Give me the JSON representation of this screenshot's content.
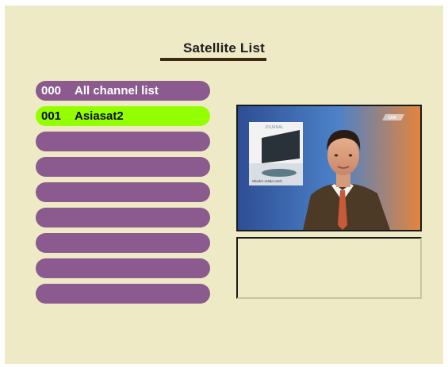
{
  "screen": {
    "title": "Satellite List",
    "colors": {
      "background": "#eeeac5",
      "item": "#8b5a8e",
      "item_selected": "#94ff00",
      "underline": "#3d2a10"
    }
  },
  "satellite_list": [
    {
      "number": "000",
      "name": "All channel list",
      "selected": false
    },
    {
      "number": "001",
      "name": "Asiasat2",
      "selected": true
    },
    {
      "number": "",
      "name": "",
      "selected": false
    },
    {
      "number": "",
      "name": "",
      "selected": false
    },
    {
      "number": "",
      "name": "",
      "selected": false
    },
    {
      "number": "",
      "name": "",
      "selected": false
    },
    {
      "number": "",
      "name": "",
      "selected": false
    },
    {
      "number": "",
      "name": "",
      "selected": false
    },
    {
      "number": "",
      "name": "",
      "selected": false
    }
  ],
  "preview": {
    "channel_logo": "dw-logo",
    "inset_caption": "Wieder mäda nach",
    "inset_heading": "JOURNAL"
  },
  "info_panel": {
    "text": ""
  }
}
